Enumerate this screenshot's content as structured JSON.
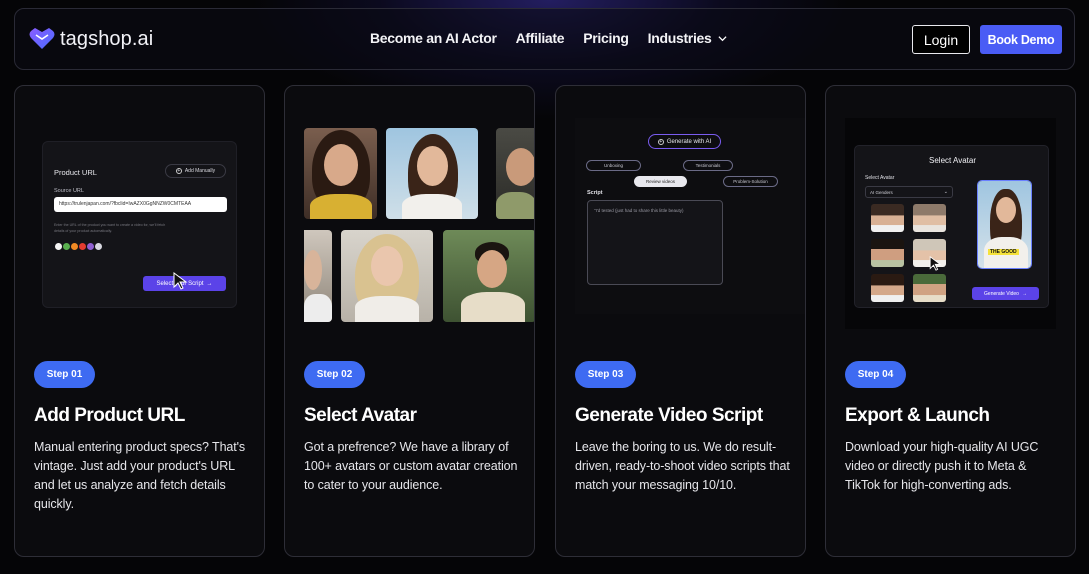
{
  "brand": {
    "name": "tagshop.ai",
    "accent": "#4a5cf5"
  },
  "nav": {
    "links": [
      "Become an AI Actor",
      "Affiliate",
      "Pricing"
    ],
    "industries_label": "Industries",
    "login": "Login",
    "book_demo": "Book Demo"
  },
  "cards": [
    {
      "step": "Step 01",
      "title": "Add Product URL",
      "desc": "Manual entering product specs? That's vintage. Just add your product's URL and let us analyze and fetch details quickly.",
      "visual": {
        "label": "Product URL",
        "add_manually": "Add Manually",
        "source_label": "Source URL",
        "url": "https://trulenjapan.com/?fbclid=IwAZX0GgNNZW0CMTEAA",
        "hint": "Enter the URL of the product you want to create a video for, we'll fetch details of your product automatically.",
        "button": "Select your Script"
      }
    },
    {
      "step": "Step 02",
      "title": "Select Avatar",
      "desc": "Got a prefrence? We have a library of 100+ avatars or custom avatar creation to cater to your audience."
    },
    {
      "step": "Step 03",
      "title": "Generate Video Script",
      "desc": "Leave the boring to us. We do result-driven, ready-to-shoot video scripts that match your messaging 10/10.",
      "visual": {
        "generate": "Generate with AI",
        "pills": [
          "Unboxing",
          "Testimonials",
          "Review videos",
          "Problem-Solution"
        ],
        "script_label": "Script",
        "script_text": "\"I'd tested (just had to share this little beauty)"
      }
    },
    {
      "step": "Step 04",
      "title": "Export & Launch",
      "desc": "Download your high-quality AI UGC video or directly push it to Meta & TikTok for high-converting ads.",
      "visual": {
        "title": "Select Avatar",
        "sub": "Select Avatar",
        "dropdown": "AI Genders",
        "button": "Generate Video",
        "caption": "THE GOOD"
      }
    }
  ]
}
